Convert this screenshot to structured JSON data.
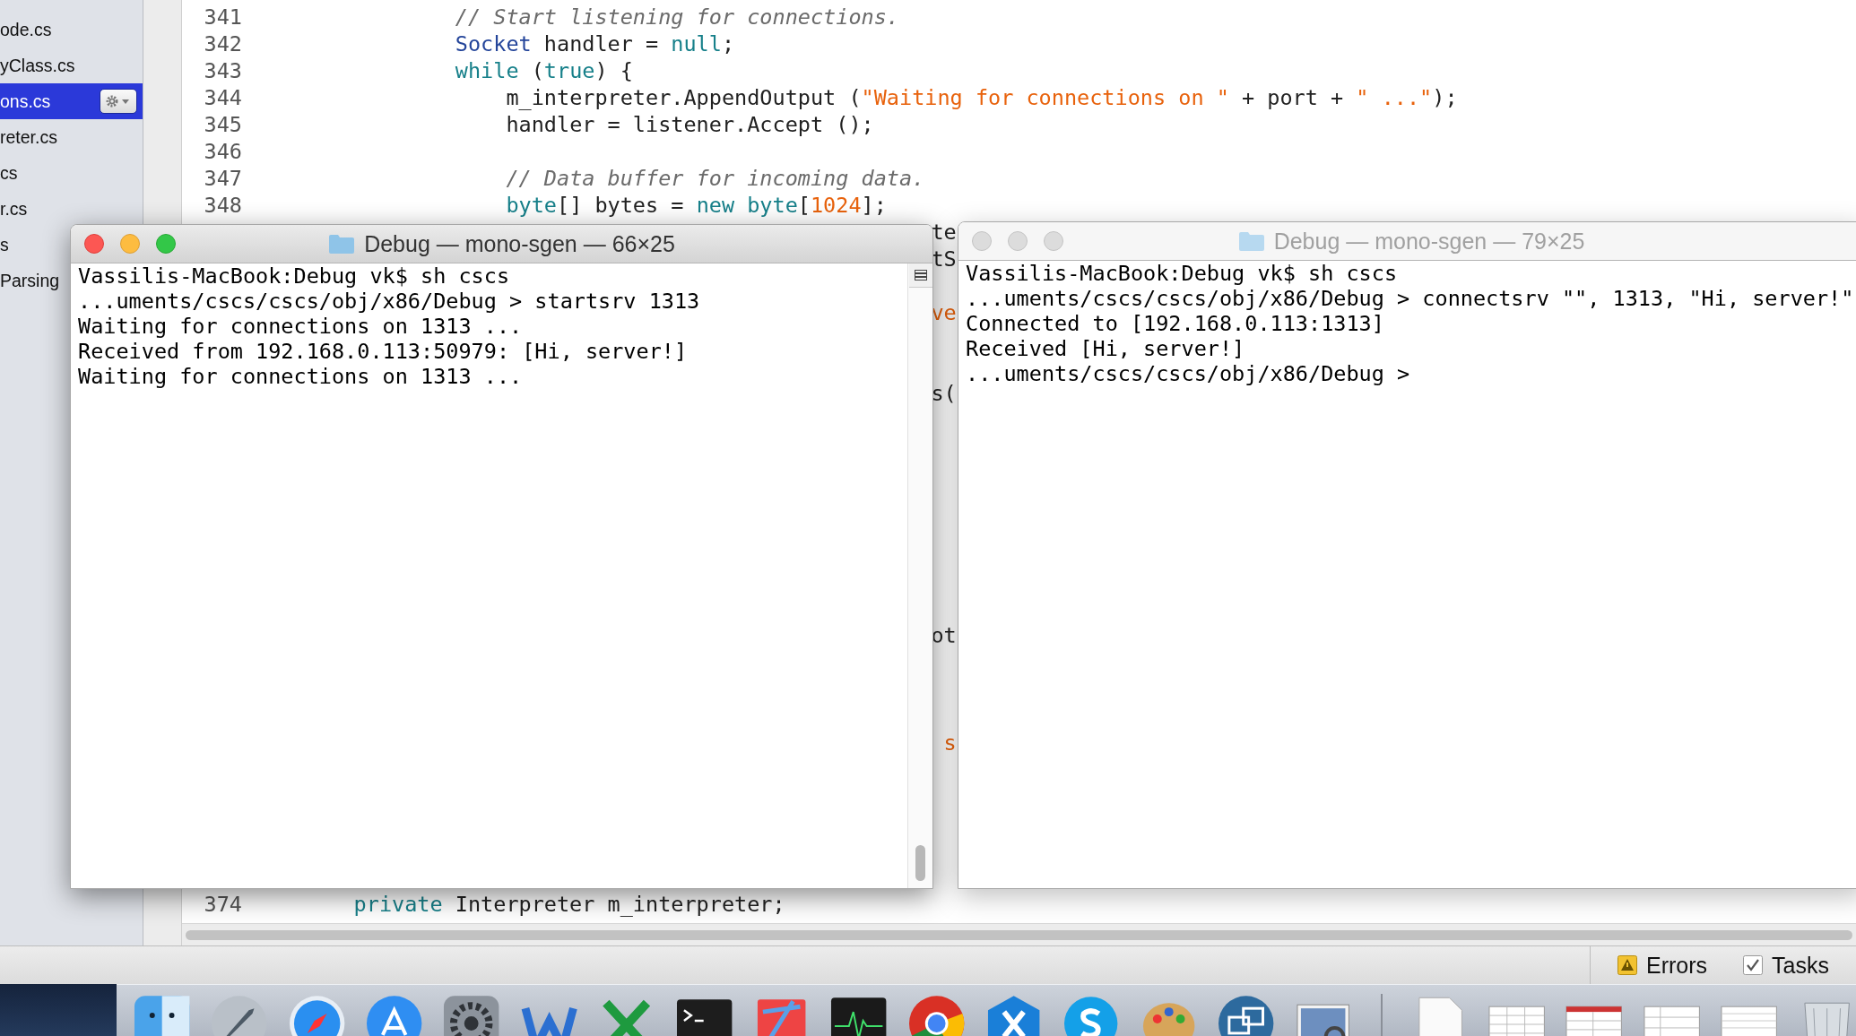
{
  "sidebar": {
    "items": [
      {
        "label": "ode.cs",
        "selected": false
      },
      {
        "label": "yClass.cs",
        "selected": false
      },
      {
        "label": "ons.cs",
        "selected": true
      },
      {
        "label": "reter.cs",
        "selected": false
      },
      {
        "label": "cs",
        "selected": false
      },
      {
        "label": "r.cs",
        "selected": false
      },
      {
        "label": "s",
        "selected": false
      },
      {
        "label": "Parsing",
        "selected": false
      }
    ]
  },
  "editor": {
    "lines": [
      {
        "number": "341",
        "tokens": [
          {
            "kind": "comment",
            "text": "// Start listening for connections."
          }
        ]
      },
      {
        "number": "342",
        "tokens": [
          {
            "kind": "type",
            "text": "Socket"
          },
          {
            "kind": "plain",
            "text": " handler = "
          },
          {
            "kind": "keyword",
            "text": "null"
          },
          {
            "kind": "plain",
            "text": ";"
          }
        ]
      },
      {
        "number": "343",
        "tokens": [
          {
            "kind": "keyword",
            "text": "while"
          },
          {
            "kind": "plain",
            "text": " ("
          },
          {
            "kind": "keyword",
            "text": "true"
          },
          {
            "kind": "plain",
            "text": ") {"
          }
        ]
      },
      {
        "number": "344",
        "tokens": [
          {
            "kind": "plain",
            "text": "m_interpreter.AppendOutput ("
          },
          {
            "kind": "string",
            "text": "\"Waiting for connections on \""
          },
          {
            "kind": "plain",
            "text": " + port + "
          },
          {
            "kind": "string",
            "text": "\" ...\""
          },
          {
            "kind": "plain",
            "text": ");"
          }
        ]
      },
      {
        "number": "345",
        "tokens": [
          {
            "kind": "plain",
            "text": "handler = listener.Accept ();"
          }
        ]
      },
      {
        "number": "346"
      },
      {
        "number": "347",
        "tokens": [
          {
            "kind": "comment",
            "text": "// Data buffer for incoming data."
          }
        ]
      },
      {
        "number": "348",
        "tokens": [
          {
            "kind": "keyword",
            "text": "byte"
          },
          {
            "kind": "plain",
            "text": "[] bytes = "
          },
          {
            "kind": "keyword",
            "text": "new byte"
          },
          {
            "kind": "plain",
            "text": "["
          },
          {
            "kind": "number",
            "text": "1024"
          },
          {
            "kind": "plain",
            "text": "];"
          }
        ]
      }
    ],
    "fragments": [
      {
        "kind": "plain",
        "text": "te"
      },
      {
        "kind": "plain",
        "text": "tS"
      },
      {
        "kind": "string",
        "text": "ve"
      },
      {
        "kind": "plain",
        "text": "s("
      },
      {
        "kind": "plain",
        "text": "ot"
      },
      {
        "kind": "string",
        "text": "s"
      }
    ],
    "last_line": {
      "number": "374",
      "tokens": [
        {
          "kind": "keyword",
          "text": "private"
        },
        {
          "kind": "plain",
          "text": " Interpreter m_interpreter;"
        }
      ]
    }
  },
  "terminals": [
    {
      "title": "Debug — mono-sgen — 66×25",
      "active": true,
      "lines": [
        "Vassilis-MacBook:Debug vk$ sh cscs",
        "...uments/cscs/cscs/obj/x86/Debug > startsrv 1313",
        "Waiting for connections on 1313 ...",
        "Received from 192.168.0.113:50979: [Hi, server!]",
        "Waiting for connections on 1313 ..."
      ]
    },
    {
      "title": "Debug — mono-sgen — 79×25",
      "active": false,
      "lines": [
        "Vassilis-MacBook:Debug vk$ sh cscs",
        "...uments/cscs/cscs/obj/x86/Debug > connectsrv \"\", 1313, \"Hi, server!\"",
        "Connected to [192.168.0.113:1313]",
        "Received [Hi, server!]",
        "...uments/cscs/cscs/obj/x86/Debug >"
      ]
    }
  ],
  "status_bar": {
    "items": [
      {
        "kind": "warning",
        "label": "Errors"
      },
      {
        "kind": "check",
        "label": "Tasks"
      }
    ]
  }
}
